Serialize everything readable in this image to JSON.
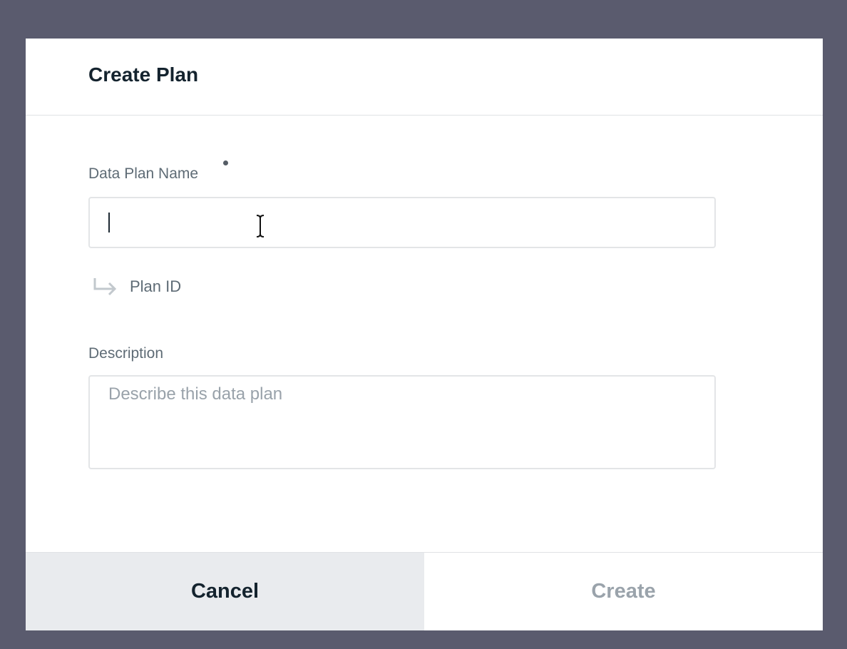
{
  "dialog": {
    "title": "Create Plan"
  },
  "form": {
    "name_field": {
      "label": "Data Plan Name",
      "value": "",
      "required": true
    },
    "plan_id": {
      "label": "Plan ID",
      "icon": "return-arrow-icon"
    },
    "description_field": {
      "label": "Description",
      "placeholder": "Describe this data plan",
      "value": ""
    }
  },
  "footer": {
    "cancel_label": "Cancel",
    "create_label": "Create",
    "create_enabled": false
  },
  "colors": {
    "backdrop": "#5a5b6e",
    "title_text": "#14232e",
    "label_text": "#5e6b75",
    "disabled_text": "#9aa3ab",
    "cancel_bg": "#e9ebee"
  }
}
